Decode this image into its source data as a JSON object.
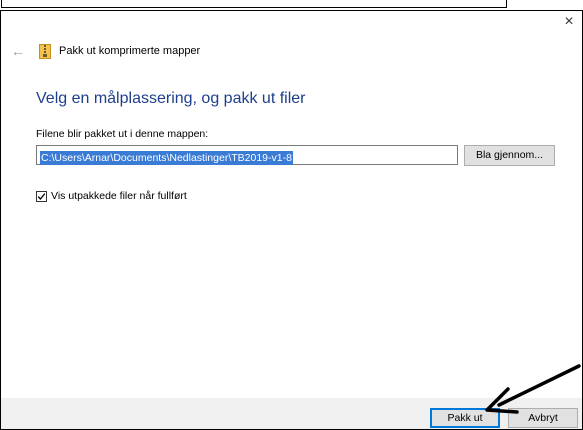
{
  "dialog": {
    "wizard_name": "Pakk ut komprimerte mapper",
    "heading": "Velg en målplassering, og pakk ut filer",
    "path_label": "Filene blir pakket ut i denne mappen:",
    "path_value": "C:\\Users\\Arnar\\Documents\\Nedlastinger\\TB2019-v1-8",
    "browse_label": "Bla gjennom...",
    "checkbox_label": "Vis utpakkede filer når fullført",
    "checkbox_checked": true,
    "close_glyph": "×",
    "back_glyph": "←"
  },
  "footer": {
    "extract_label": "Pakk ut",
    "cancel_label": "Avbryt"
  },
  "icons": {
    "back": "back-arrow-icon",
    "zip": "zip-folder-icon",
    "close": "close-icon",
    "checkmark": "checkmark-icon",
    "annotation": "annotation-arrow"
  },
  "colors": {
    "heading": "#1e3f8c",
    "selection": "#3a7bd5",
    "primary_border": "#0078d7",
    "footer_bg": "#f0f0f0",
    "zip_icon": "#e8b32e"
  }
}
